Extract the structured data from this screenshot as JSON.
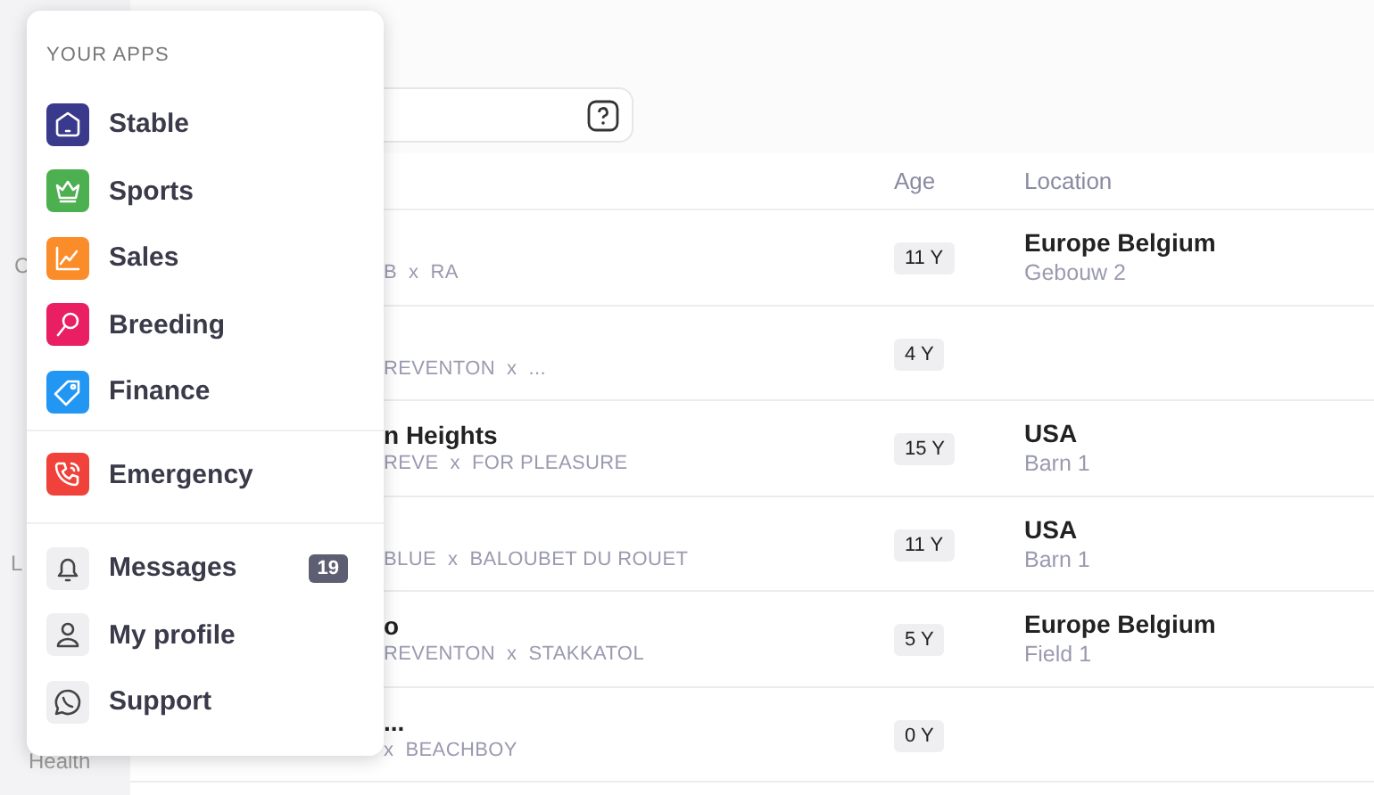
{
  "sidebar": {
    "items": [
      {
        "label": "C",
        "selected": false
      },
      {
        "label": "L",
        "selected": false
      },
      {
        "label": "Health",
        "selected": false
      }
    ]
  },
  "table": {
    "columns": [
      "Age",
      "Location"
    ],
    "rows": [
      {
        "name": "",
        "sub": "B  x  RA",
        "age": "11 Y",
        "location": "Europe Belgium",
        "place": "Gebouw 2"
      },
      {
        "name": "",
        "sub": "REVENTON  x  ...",
        "age": "4 Y",
        "location": "",
        "place": ""
      },
      {
        "name": "n Heights",
        "sub": "REVE  x  FOR PLEASURE",
        "age": "15 Y",
        "location": "USA",
        "place": "Barn 1"
      },
      {
        "name": "",
        "sub": "BLUE  x  BALOUBET DU ROUET",
        "age": "11 Y",
        "location": "USA",
        "place": "Barn 1"
      },
      {
        "name": "o",
        "sub": "REVENTON  x  STAKKATOL",
        "age": "5 Y",
        "location": "Europe Belgium",
        "place": "Field 1"
      },
      {
        "name": "...",
        "sub": "x  BEACHBOY",
        "age": "0 Y",
        "location": "",
        "place": ""
      }
    ]
  },
  "menu": {
    "heading": "YOUR APPS",
    "groups": [
      [
        {
          "label": "Stable",
          "kind": "home",
          "color": "#3a3a8c"
        },
        {
          "label": "Sports",
          "kind": "crown",
          "color": "#4caf50"
        },
        {
          "label": "Sales",
          "kind": "chart",
          "color": "#fb8c2a"
        },
        {
          "label": "Breeding",
          "kind": "search",
          "color": "#e91e63"
        },
        {
          "label": "Finance",
          "kind": "tag",
          "color": "#2196f3"
        }
      ],
      [
        {
          "label": "Emergency",
          "kind": "phone",
          "color": "#f0413a"
        }
      ],
      [
        {
          "label": "Messages",
          "kind": "bell",
          "badge": "19"
        },
        {
          "label": "My profile",
          "kind": "user"
        },
        {
          "label": "Support",
          "kind": "chat"
        }
      ]
    ]
  }
}
